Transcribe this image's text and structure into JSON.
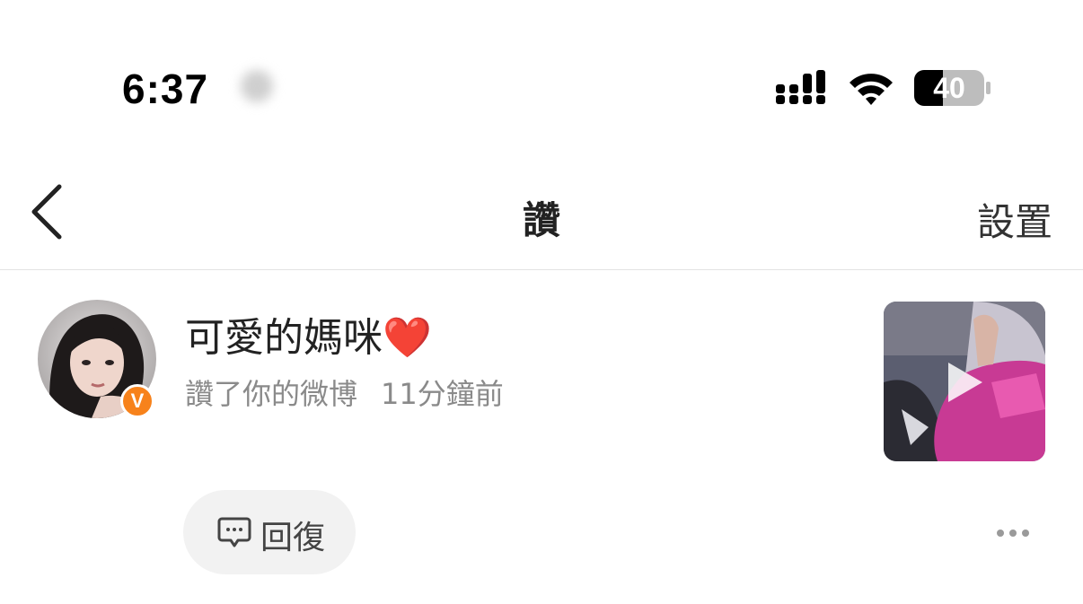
{
  "status_bar": {
    "time": "6:37",
    "battery_level": "40",
    "icons": [
      "signal-icon",
      "wifi-icon",
      "battery-icon"
    ]
  },
  "nav": {
    "back_icon": "chevron-left-icon",
    "title": "讚",
    "settings_label": "設置"
  },
  "notification": {
    "username": "可愛的媽咪",
    "username_emoji": "❤️",
    "verified_badge": "V",
    "action_text": "讚了你的微博",
    "time_ago": "11分鐘前",
    "thumbnail_icon": "play-icon",
    "reply_label": "回復",
    "reply_icon": "comment-icon",
    "more_icon": "more-dots-icon"
  },
  "colors": {
    "badge": "#f7821b",
    "heart": "#e3161f",
    "muted_text": "#8a8a8a",
    "reply_bg": "#f2f2f2"
  }
}
